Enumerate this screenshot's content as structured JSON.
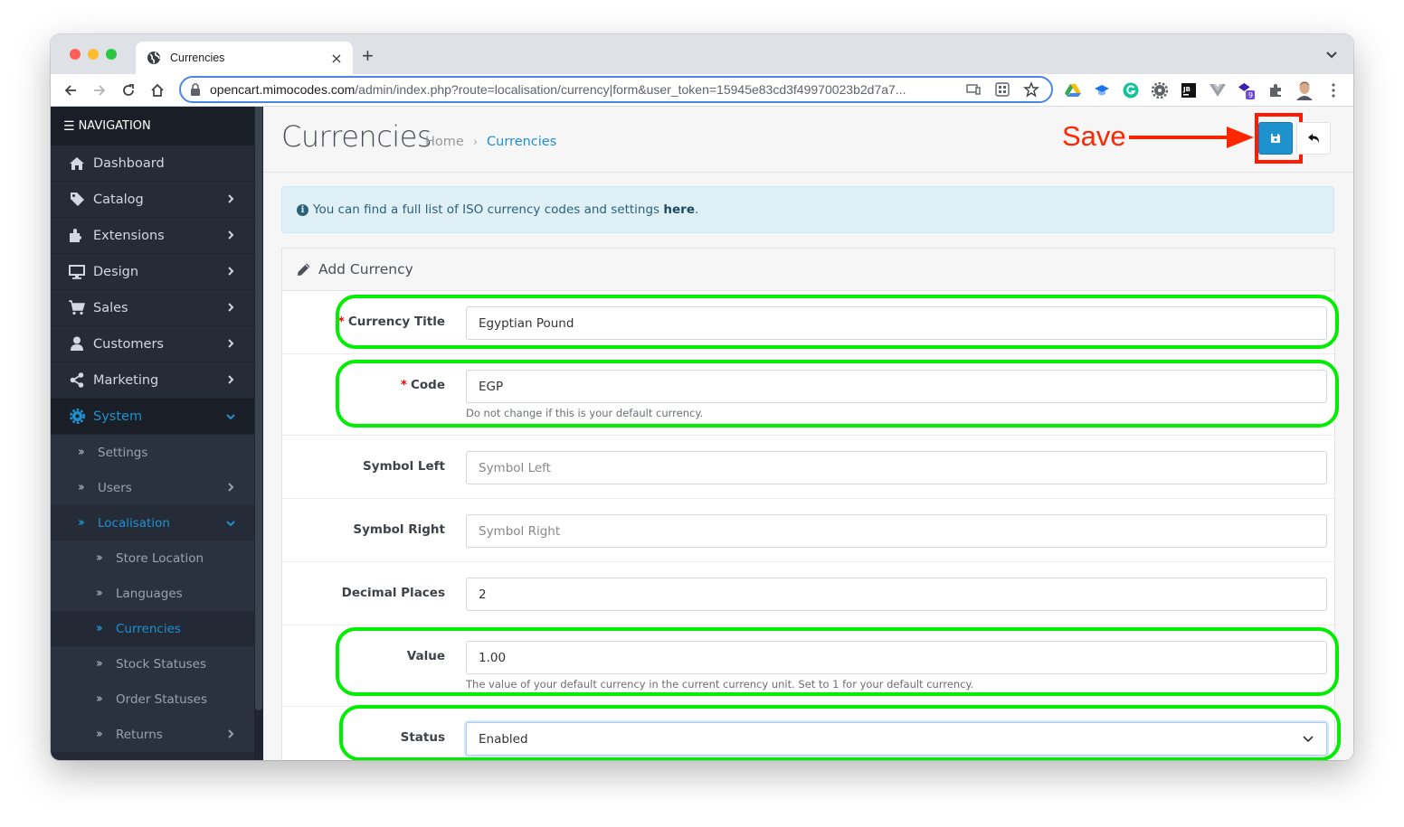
{
  "browser": {
    "tab_title": "Currencies",
    "tab_close": "×",
    "new_tab": "+",
    "url_host": "opencart.mimocodes.com",
    "url_path": "/admin/index.php?route=localisation/currency|form&user_token=15945e83cd3f49970023b2d7a7...",
    "extension_badge": "9"
  },
  "sidebar": {
    "header": "NAVIGATION",
    "items": [
      {
        "label": "Dashboard",
        "icon": "home-icon"
      },
      {
        "label": "Catalog",
        "icon": "tag-icon"
      },
      {
        "label": "Extensions",
        "icon": "puzzle-icon"
      },
      {
        "label": "Design",
        "icon": "monitor-icon"
      },
      {
        "label": "Sales",
        "icon": "cart-icon"
      },
      {
        "label": "Customers",
        "icon": "user-icon"
      },
      {
        "label": "Marketing",
        "icon": "share-icon"
      },
      {
        "label": "System",
        "icon": "gear-icon"
      }
    ],
    "system_sub": [
      {
        "label": "Settings"
      },
      {
        "label": "Users"
      },
      {
        "label": "Localisation"
      }
    ],
    "localisation_sub": [
      {
        "label": "Store Location"
      },
      {
        "label": "Languages"
      },
      {
        "label": "Currencies"
      },
      {
        "label": "Stock Statuses"
      },
      {
        "label": "Order Statuses"
      },
      {
        "label": "Returns"
      }
    ]
  },
  "header": {
    "title": "Currencies",
    "breadcrumb": [
      "Home",
      "Currencies"
    ],
    "breadcrumb_sep": "›"
  },
  "annotation": {
    "save_label": "Save",
    "color": "#ff2600",
    "highlight_color": "#00ee00"
  },
  "alert": {
    "text": "You can find a full list of ISO currency codes and settings ",
    "link": "here",
    "suffix": "."
  },
  "form": {
    "heading": "Add Currency",
    "required_mark": "*",
    "fields": {
      "title": {
        "label": "Currency Title",
        "value": "Egyptian Pound",
        "required": true
      },
      "code": {
        "label": "Code",
        "value": "EGP",
        "required": true,
        "help": "Do not change if this is your default currency."
      },
      "symbol_left": {
        "label": "Symbol Left",
        "placeholder": "Symbol Left",
        "value": ""
      },
      "symbol_right": {
        "label": "Symbol Right",
        "placeholder": "Symbol Right",
        "value": ""
      },
      "decimal_places": {
        "label": "Decimal Places",
        "value": "2"
      },
      "value": {
        "label": "Value",
        "value": "1.00",
        "help": "The value of your default currency in the current currency unit. Set to 1 for your default currency."
      },
      "status": {
        "label": "Status",
        "value": "Enabled"
      }
    }
  },
  "colors": {
    "accent": "#1e91cf",
    "sidebar_bg": "#232a36",
    "alert_bg": "#dff0f7"
  }
}
